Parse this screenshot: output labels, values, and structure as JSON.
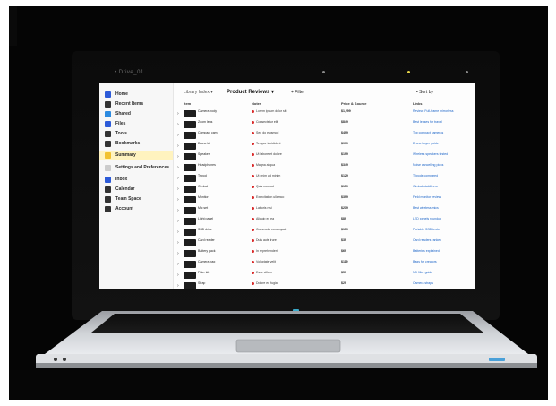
{
  "photo": {
    "subject": "laptop-on-black-background",
    "screen_app": {
      "topbar_text": "• Drive_01",
      "toolbar": {
        "crumb": "Library Index ▾",
        "title": "Product Reviews ▾",
        "action": "+ Filter",
        "right": "• Sort by"
      },
      "columns": [
        "Item",
        "Notes",
        "Price & Source",
        "Links"
      ],
      "sidebar": [
        {
          "label": "Home",
          "icon": "home-icon",
          "color": "#2d5bd8"
        },
        {
          "label": "Recent Items",
          "icon": "clock-icon",
          "color": "#333333"
        },
        {
          "label": "Shared",
          "icon": "shared-icon",
          "color": "#2d8be0"
        },
        {
          "label": "Files",
          "icon": "file-icon",
          "color": "#2d5bd8"
        },
        {
          "label": "Tools",
          "icon": "tool-icon",
          "color": "#333333"
        },
        {
          "label": "Bookmarks",
          "icon": "bookmark-icon",
          "color": "#333333"
        },
        {
          "label": "Summary",
          "icon": "summary-icon",
          "color": "#f2c230"
        },
        {
          "label": "Settings and Preferences",
          "icon": "settings-icon",
          "color": "#cccccc"
        },
        {
          "label": "Inbox",
          "icon": "inbox-icon",
          "color": "#2d5bd8"
        },
        {
          "label": "Calendar",
          "icon": "calendar-icon",
          "color": "#333333"
        },
        {
          "label": "Team Space",
          "icon": "team-icon",
          "color": "#333333"
        },
        {
          "label": "Account",
          "icon": "account-icon",
          "color": "#333333"
        }
      ],
      "rows": [
        {
          "name": "Camera body",
          "rev": "Lorem ipsum dolor sit",
          "price": "$1,299",
          "link": "Review: Full-frame mirrorless"
        },
        {
          "name": "Zoom lens",
          "rev": "Consectetur elit",
          "price": "$849",
          "link": "Best lenses for travel"
        },
        {
          "name": "Compact cam",
          "rev": "Sed do eiusmod",
          "price": "$499",
          "link": "Top compact cameras"
        },
        {
          "name": "Drone kit",
          "rev": "Tempor incididunt",
          "price": "$999",
          "link": "Drone buyer guide"
        },
        {
          "name": "Speaker",
          "rev": "Ut labore et dolore",
          "price": "$199",
          "link": "Wireless speakers tested"
        },
        {
          "name": "Headphones",
          "rev": "Magna aliqua",
          "price": "$349",
          "link": "Noise cancelling picks"
        },
        {
          "name": "Tripod",
          "rev": "Ut enim ad minim",
          "price": "$129",
          "link": "Tripods compared"
        },
        {
          "name": "Gimbal",
          "rev": "Quis nostrud",
          "price": "$159",
          "link": "Gimbal stabilizers"
        },
        {
          "name": "Monitor",
          "rev": "Exercitation ullamco",
          "price": "$399",
          "link": "Field monitor review"
        },
        {
          "name": "Mic set",
          "rev": "Laboris nisi",
          "price": "$219",
          "link": "Best wireless mics"
        },
        {
          "name": "Light panel",
          "rev": "Aliquip ex ea",
          "price": "$89",
          "link": "LED panels roundup"
        },
        {
          "name": "SSD drive",
          "rev": "Commodo consequat",
          "price": "$179",
          "link": "Portable SSD tests"
        },
        {
          "name": "Card reader",
          "rev": "Duis aute irure",
          "price": "$39",
          "link": "Card readers ranked"
        },
        {
          "name": "Battery pack",
          "rev": "In reprehenderit",
          "price": "$69",
          "link": "Batteries explained"
        },
        {
          "name": "Camera bag",
          "rev": "Voluptate velit",
          "price": "$119",
          "link": "Bags for creators"
        },
        {
          "name": "Filter kit",
          "rev": "Esse cillum",
          "price": "$59",
          "link": "ND filter guide"
        },
        {
          "name": "Strap",
          "rev": "Dolore eu fugiat",
          "price": "$29",
          "link": "Camera straps"
        }
      ]
    },
    "colors": {
      "background": "#050505",
      "laptop_silver": "#cfd2d6",
      "accent_link": "#1a63c7",
      "active_item": "#fff3bf"
    }
  }
}
